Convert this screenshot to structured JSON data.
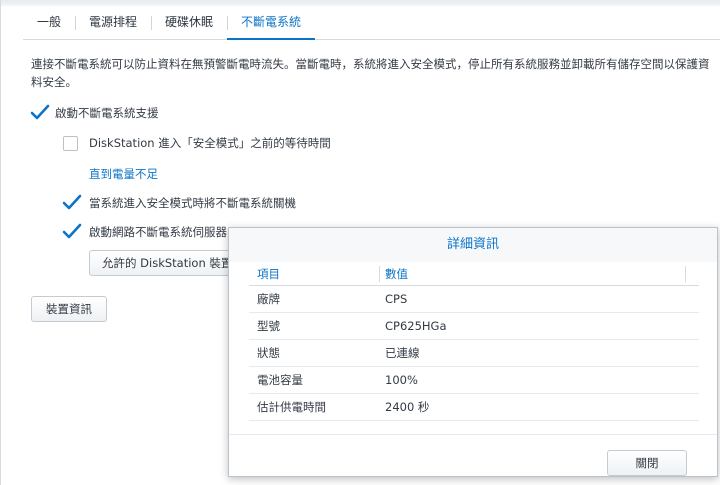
{
  "tabs": [
    {
      "label": "一般"
    },
    {
      "label": "電源排程"
    },
    {
      "label": "硬碟休眠"
    },
    {
      "label": "不斷電系統"
    }
  ],
  "description": "連接不斷電系統可以防止資料在無預警斷電時流失。當斷電時，系統將進入安全模式，停止所有系統服務並卸載所有儲存空間以保護資料安全。",
  "options": {
    "enable_ups": {
      "label": "啟動不斷電系統支援",
      "checked": true
    },
    "wait_time": {
      "label": "DiskStation 進入「安全模式」之前的等待時間",
      "checked": false
    },
    "wait_value": "直到電量不足",
    "shutdown_ups": {
      "label": "當系統進入安全模式時將不斷電系統關機",
      "checked": true
    },
    "network_server": {
      "label": "啟動網路不斷電系統伺服器",
      "checked": true
    }
  },
  "buttons": {
    "permitted_devices": "允許的 DiskStation 裝置",
    "device_info": "裝置資訊"
  },
  "dialog": {
    "title": "詳細資訊",
    "columns": {
      "item": "項目",
      "value": "數值"
    },
    "rows": [
      {
        "item": "廠牌",
        "value": "CPS"
      },
      {
        "item": "型號",
        "value": "CP625HGa"
      },
      {
        "item": "狀態",
        "value": "已連線"
      },
      {
        "item": "電池容量",
        "value": "100%"
      },
      {
        "item": "估計供電時間",
        "value": "2400 秒"
      }
    ],
    "close_label": "關閉"
  },
  "colors": {
    "accent": "#0b74c9"
  }
}
